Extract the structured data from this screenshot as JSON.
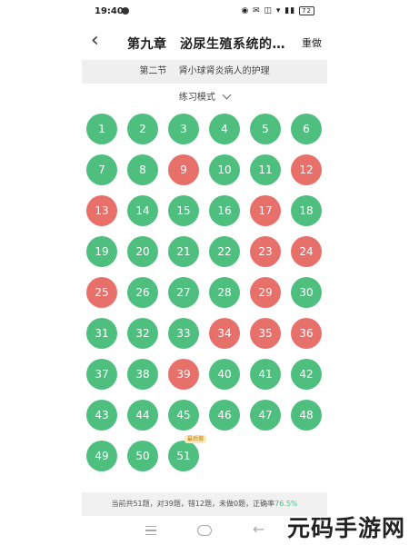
{
  "status": {
    "time": "19:40",
    "icons": "◉ ✉ ◫ ▾ ▮▮",
    "battery": "72"
  },
  "header": {
    "title": "第九章　泌尿生殖系统的…",
    "action": "重做"
  },
  "section": {
    "number": "第二节",
    "name": "肾小球肾炎病人的护理"
  },
  "mode": {
    "label": "练习模式"
  },
  "colors": {
    "correct": "#4fbf7f",
    "wrong": "#e8706a"
  },
  "questions": [
    {
      "n": "1",
      "s": "ok"
    },
    {
      "n": "2",
      "s": "ok"
    },
    {
      "n": "3",
      "s": "ok"
    },
    {
      "n": "4",
      "s": "ok"
    },
    {
      "n": "5",
      "s": "ok"
    },
    {
      "n": "6",
      "s": "ok"
    },
    {
      "n": "7",
      "s": "ok"
    },
    {
      "n": "8",
      "s": "ok"
    },
    {
      "n": "9",
      "s": "bad"
    },
    {
      "n": "10",
      "s": "ok"
    },
    {
      "n": "11",
      "s": "ok"
    },
    {
      "n": "12",
      "s": "bad"
    },
    {
      "n": "13",
      "s": "bad"
    },
    {
      "n": "14",
      "s": "ok"
    },
    {
      "n": "15",
      "s": "ok"
    },
    {
      "n": "16",
      "s": "ok"
    },
    {
      "n": "17",
      "s": "bad"
    },
    {
      "n": "18",
      "s": "ok"
    },
    {
      "n": "19",
      "s": "ok"
    },
    {
      "n": "20",
      "s": "ok"
    },
    {
      "n": "21",
      "s": "ok"
    },
    {
      "n": "22",
      "s": "ok"
    },
    {
      "n": "23",
      "s": "bad"
    },
    {
      "n": "24",
      "s": "bad"
    },
    {
      "n": "25",
      "s": "bad"
    },
    {
      "n": "26",
      "s": "ok"
    },
    {
      "n": "27",
      "s": "ok"
    },
    {
      "n": "28",
      "s": "ok"
    },
    {
      "n": "29",
      "s": "bad"
    },
    {
      "n": "30",
      "s": "ok"
    },
    {
      "n": "31",
      "s": "ok"
    },
    {
      "n": "32",
      "s": "ok"
    },
    {
      "n": "33",
      "s": "ok"
    },
    {
      "n": "34",
      "s": "bad"
    },
    {
      "n": "35",
      "s": "bad"
    },
    {
      "n": "36",
      "s": "bad"
    },
    {
      "n": "37",
      "s": "ok"
    },
    {
      "n": "38",
      "s": "ok"
    },
    {
      "n": "39",
      "s": "bad"
    },
    {
      "n": "40",
      "s": "ok"
    },
    {
      "n": "41",
      "s": "ok"
    },
    {
      "n": "42",
      "s": "ok"
    },
    {
      "n": "43",
      "s": "ok"
    },
    {
      "n": "44",
      "s": "ok"
    },
    {
      "n": "45",
      "s": "ok"
    },
    {
      "n": "46",
      "s": "ok"
    },
    {
      "n": "47",
      "s": "ok"
    },
    {
      "n": "48",
      "s": "ok"
    },
    {
      "n": "49",
      "s": "ok"
    },
    {
      "n": "50",
      "s": "ok"
    },
    {
      "n": "51",
      "s": "ok",
      "badge": "最后做"
    }
  ],
  "summary": {
    "text": "当前共51题，对39题，错12题，未做0题，正确率",
    "rate": "76.5%"
  },
  "watermark": "元码手游网"
}
